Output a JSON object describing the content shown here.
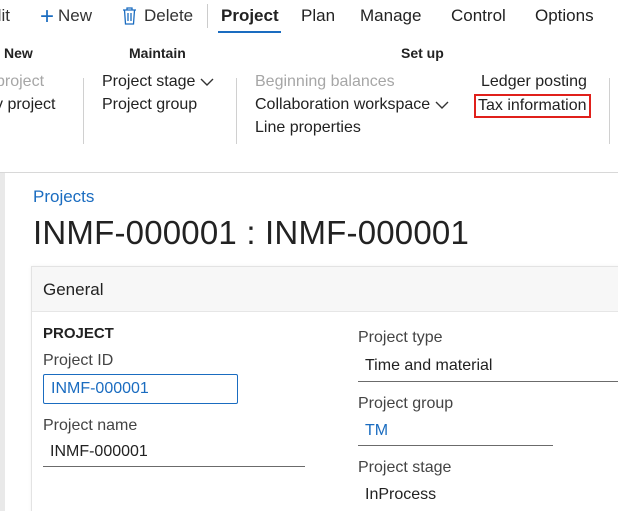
{
  "toolbar": {
    "edit_label": "dit",
    "new_label": "New",
    "delete_label": "Delete"
  },
  "tabs": [
    {
      "label": "Project",
      "active": true
    },
    {
      "label": "Plan"
    },
    {
      "label": "Manage"
    },
    {
      "label": "Control"
    },
    {
      "label": "Options"
    }
  ],
  "ribbon": {
    "new_group": {
      "header": "New",
      "items": [
        "project",
        "y project"
      ]
    },
    "maintain_group": {
      "header": "Maintain",
      "items": [
        "Project stage",
        "Project group"
      ]
    },
    "setup_group": {
      "header": "Set up",
      "items": [
        "Beginning balances",
        "Collaboration workspace",
        "Line properties",
        "Ledger posting",
        "Tax information"
      ]
    }
  },
  "page": {
    "breadcrumb": "Projects",
    "title": "INMF-000001 : INMF-000001"
  },
  "card": {
    "title": "General",
    "section": "PROJECT",
    "project_id_label": "Project ID",
    "project_id_value": "INMF-000001",
    "project_name_label": "Project name",
    "project_name_value": "INMF-000001",
    "project_type_label": "Project type",
    "project_type_value": "Time and material",
    "project_group_label": "Project group",
    "project_group_value": "TM",
    "project_stage_label": "Project stage",
    "project_stage_value": "InProcess"
  },
  "colors": {
    "accent": "#1a6cc0",
    "highlight": "#e0201b",
    "disabled": "#a6a6a6"
  }
}
